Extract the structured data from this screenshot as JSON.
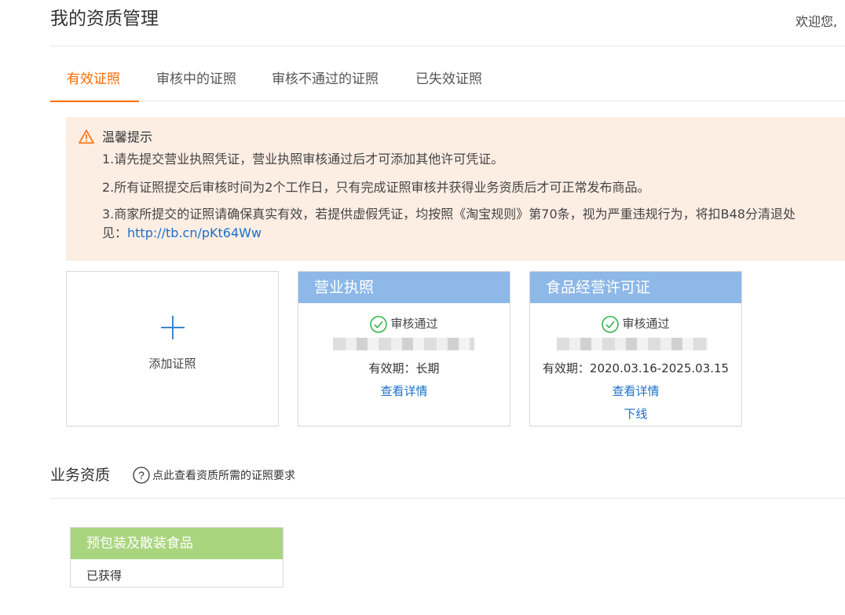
{
  "header": {
    "title": "我的资质管理",
    "welcome": "欢迎您,"
  },
  "tabs": [
    {
      "label": "有效证照",
      "active": true
    },
    {
      "label": "审核中的证照",
      "active": false
    },
    {
      "label": "审核不通过的证照",
      "active": false
    },
    {
      "label": "已失效证照",
      "active": false
    }
  ],
  "notice": {
    "title": "温馨提示",
    "lines": [
      "1.请先提交营业执照凭证，营业执照审核通过后才可添加其他许可凭证。",
      "2.所有证照提交后审核时间为2个工作日，只有完成证照审核并获得业务资质后才可正常发布商品。",
      "3.商家所提交的证照请确保真实有效，若提供虚假凭证，均按照《淘宝规则》第70条，视为严重违规行为，将扣B48分清退处"
    ],
    "link_prefix": "见：",
    "link": "http://tb.cn/pKt64Ww"
  },
  "cards": {
    "add": {
      "label": "添加证照",
      "icon": "plus-icon"
    },
    "business_license": {
      "title": "营业执照",
      "status": "审核通过",
      "validity_label": "有效期：",
      "validity": "长期",
      "detail": "查看详情"
    },
    "food_license": {
      "title": "食品经营许可证",
      "status": "审核通过",
      "validity_label": "有效期：",
      "validity": "2020.03.16-2025.03.15",
      "detail": "查看详情",
      "offline": "下线"
    }
  },
  "qualification": {
    "section_title": "业务资质",
    "help_text": "点此查看资质所需的证照要求",
    "items": [
      {
        "name": "预包装及散装食品",
        "status": "已获得"
      }
    ]
  },
  "colors": {
    "accent": "#ff6a00",
    "link": "#1a6fc9",
    "card_header_blue": "#8db8e8",
    "card_header_green": "#a9d57f",
    "notice_bg": "#fdeee4",
    "success": "#2fb24a"
  }
}
